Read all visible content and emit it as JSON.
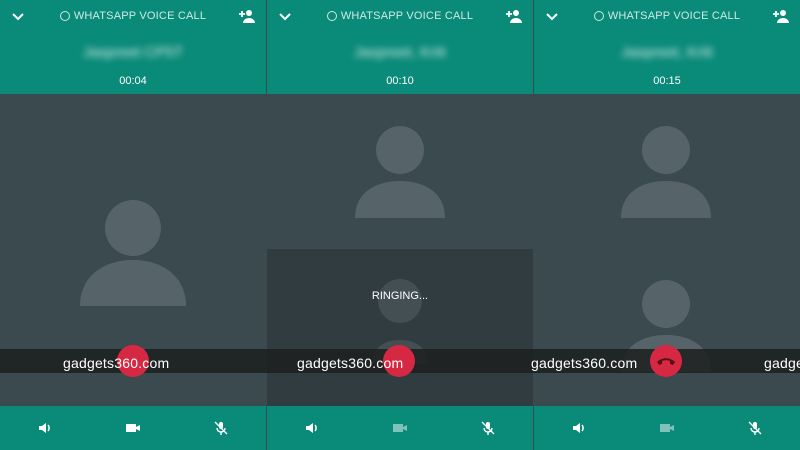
{
  "colors": {
    "header": "#0a8a79",
    "body": "#3b4a4f",
    "end_call": "#d62843",
    "watermark_strip": "#1c1e1f"
  },
  "screens": [
    {
      "title": "WHATSAPP VOICE CALL",
      "contact_name": "Jaspreet CP5T",
      "timer": "00:04",
      "status": "",
      "controls": [
        "speaker-icon",
        "video-icon",
        "mute-icon"
      ]
    },
    {
      "title": "WHATSAPP VOICE CALL",
      "contact_name": "Jaspreet, Kriti",
      "timer": "00:10",
      "status": "RINGING...",
      "controls": [
        "speaker-icon",
        "video-icon",
        "mute-icon"
      ]
    },
    {
      "title": "WHATSAPP VOICE CALL",
      "contact_name": "Jaspreet, Kriti",
      "timer": "00:15",
      "status": "",
      "controls": [
        "speaker-icon",
        "video-icon",
        "mute-icon"
      ]
    }
  ],
  "watermark": {
    "text_1": "gadgets360.com",
    "text_2": "gadgets360.com",
    "text_3": "gadgets360.com",
    "text_4": "gadgets"
  }
}
